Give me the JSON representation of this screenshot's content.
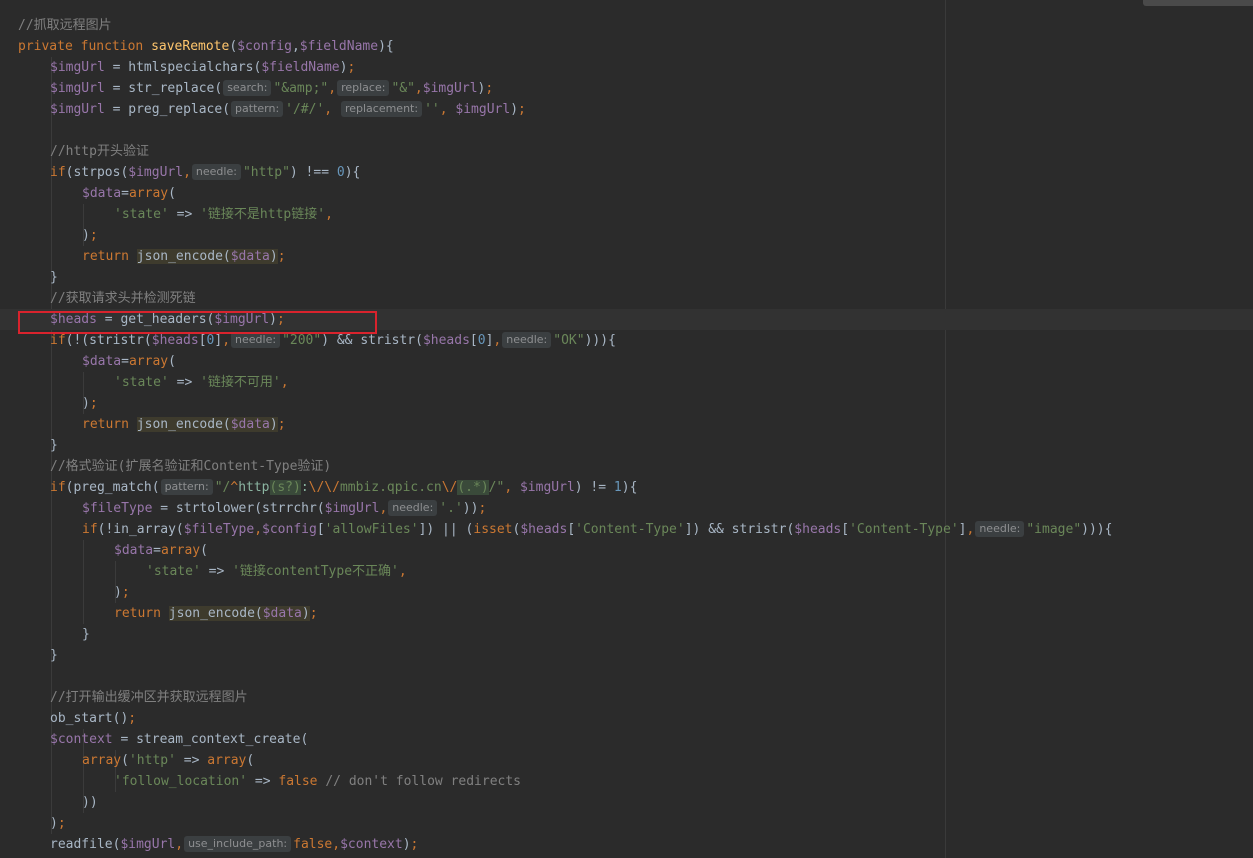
{
  "editor": {
    "theme": "darcula",
    "lines": [
      [
        [
          "com",
          "//抓取远程图片"
        ]
      ],
      [
        [
          "kw",
          "private function "
        ],
        [
          "fn",
          "saveRemote"
        ],
        [
          "def",
          "("
        ],
        [
          "var",
          "$config"
        ],
        [
          "def",
          ","
        ],
        [
          "var",
          "$fieldName"
        ],
        [
          "def",
          "){"
        ]
      ],
      [
        [
          "var",
          "$imgUrl"
        ],
        [
          "def",
          " = htmlspecialchars("
        ],
        [
          "var",
          "$fieldName"
        ],
        [
          "def",
          ")"
        ],
        [
          "kw",
          ";"
        ]
      ],
      [
        [
          "var",
          "$imgUrl"
        ],
        [
          "def",
          " = str_replace("
        ],
        [
          "hint",
          "search:"
        ],
        [
          "str",
          "\"&amp;\""
        ],
        [
          "kw",
          ","
        ],
        [
          "hint",
          "replace:"
        ],
        [
          "str",
          "\"&\""
        ],
        [
          "kw",
          ","
        ],
        [
          "var",
          "$imgUrl"
        ],
        [
          "def",
          ")"
        ],
        [
          "kw",
          ";"
        ]
      ],
      [
        [
          "var",
          "$imgUrl"
        ],
        [
          "def",
          " = preg_replace("
        ],
        [
          "hint",
          "pattern:"
        ],
        [
          "str",
          "'/#/'"
        ],
        [
          "kw",
          ", "
        ],
        [
          "hint",
          "replacement:"
        ],
        [
          "str",
          "''"
        ],
        [
          "kw",
          ", "
        ],
        [
          "var",
          "$imgUrl"
        ],
        [
          "def",
          ")"
        ],
        [
          "kw",
          ";"
        ]
      ],
      [],
      [
        [
          "com",
          "//http开头验证"
        ]
      ],
      [
        [
          "kw",
          "if"
        ],
        [
          "def",
          "(strpos("
        ],
        [
          "var",
          "$imgUrl"
        ],
        [
          "kw",
          ","
        ],
        [
          "hint",
          "needle:"
        ],
        [
          "str",
          "\"http\""
        ],
        [
          "def",
          ") !== "
        ],
        [
          "num",
          "0"
        ],
        [
          "def",
          "){"
        ]
      ],
      [
        [
          "var",
          "$data"
        ],
        [
          "def",
          "="
        ],
        [
          "kw",
          "array"
        ],
        [
          "def",
          "("
        ]
      ],
      [
        [
          "str",
          "'state'"
        ],
        [
          "def",
          " => "
        ],
        [
          "str",
          "'链接不是http链接'"
        ],
        [
          "kw",
          ","
        ]
      ],
      [
        [
          "def",
          ")"
        ],
        [
          "kw",
          ";"
        ]
      ],
      [
        [
          "kw",
          "return "
        ],
        [
          "call",
          "json_encode("
        ],
        [
          "callv",
          "$data"
        ],
        [
          "call",
          ")"
        ],
        [
          "kw",
          ";"
        ]
      ],
      [
        [
          "def",
          "}"
        ]
      ],
      [
        [
          "com",
          "//获取请求头并检测死链"
        ]
      ],
      [
        [
          "var",
          "$heads"
        ],
        [
          "def",
          " = get_headers("
        ],
        [
          "var",
          "$imgUrl"
        ],
        [
          "def",
          ")"
        ],
        [
          "kw",
          ";"
        ]
      ],
      [
        [
          "kw",
          "if"
        ],
        [
          "def",
          "(!(stristr("
        ],
        [
          "var",
          "$heads"
        ],
        [
          "def",
          "["
        ],
        [
          "num",
          "0"
        ],
        [
          "def",
          "]"
        ],
        [
          "kw",
          ","
        ],
        [
          "hint",
          "needle:"
        ],
        [
          "str",
          "\"200\""
        ],
        [
          "def",
          ") && stristr("
        ],
        [
          "var",
          "$heads"
        ],
        [
          "def",
          "["
        ],
        [
          "num",
          "0"
        ],
        [
          "def",
          "]"
        ],
        [
          "kw",
          ","
        ],
        [
          "hint",
          "needle:"
        ],
        [
          "str",
          "\"OK\""
        ],
        [
          "def",
          ")))"
        ],
        [
          "def",
          "{"
        ]
      ],
      [
        [
          "var",
          "$data"
        ],
        [
          "def",
          "="
        ],
        [
          "kw",
          "array"
        ],
        [
          "def",
          "("
        ]
      ],
      [
        [
          "str",
          "'state'"
        ],
        [
          "def",
          " => "
        ],
        [
          "str",
          "'链接不可用'"
        ],
        [
          "kw",
          ","
        ]
      ],
      [
        [
          "def",
          ")"
        ],
        [
          "kw",
          ";"
        ]
      ],
      [
        [
          "kw",
          "return "
        ],
        [
          "call",
          "json_encode("
        ],
        [
          "callv",
          "$data"
        ],
        [
          "call",
          ")"
        ],
        [
          "kw",
          ";"
        ]
      ],
      [
        [
          "def",
          "}"
        ]
      ],
      [
        [
          "com",
          "//格式验证(扩展名验证和Content-Type验证)"
        ]
      ],
      [
        [
          "kw",
          "if"
        ],
        [
          "def",
          "(preg_match("
        ],
        [
          "hint",
          "pattern:"
        ],
        [
          "str",
          "\"/"
        ],
        [
          "esc",
          "^"
        ],
        [
          "rx",
          "http"
        ],
        [
          "rxb",
          "(s?)"
        ],
        [
          "rx",
          ":"
        ],
        [
          "esc",
          "\\/\\/"
        ],
        [
          "str",
          "mmbiz.qpic.cn"
        ],
        [
          "esc",
          "\\/"
        ],
        [
          "rxb",
          "(.*)"
        ],
        [
          "str",
          "/\""
        ],
        [
          "kw",
          ", "
        ],
        [
          "var",
          "$imgUrl"
        ],
        [
          "def",
          ") != "
        ],
        [
          "num",
          "1"
        ],
        [
          "def",
          "){"
        ]
      ],
      [
        [
          "var",
          "$fileType"
        ],
        [
          "def",
          " = strtolower(strrchr("
        ],
        [
          "var",
          "$imgUrl"
        ],
        [
          "kw",
          ","
        ],
        [
          "hint",
          "needle:"
        ],
        [
          "str",
          "'.'"
        ],
        [
          "def",
          "))"
        ],
        [
          "kw",
          ";"
        ]
      ],
      [
        [
          "kw",
          "if"
        ],
        [
          "def",
          "(!in_array("
        ],
        [
          "var",
          "$fileType"
        ],
        [
          "kw",
          ","
        ],
        [
          "var",
          "$config"
        ],
        [
          "def",
          "["
        ],
        [
          "str",
          "'allowFiles'"
        ],
        [
          "def",
          "]) || ("
        ],
        [
          "kw",
          "isset"
        ],
        [
          "def",
          "("
        ],
        [
          "var",
          "$heads"
        ],
        [
          "def",
          "["
        ],
        [
          "str",
          "'Content-Type'"
        ],
        [
          "def",
          "]) && stristr("
        ],
        [
          "var",
          "$heads"
        ],
        [
          "def",
          "["
        ],
        [
          "str",
          "'Content-Type'"
        ],
        [
          "def",
          "]"
        ],
        [
          "kw",
          ","
        ],
        [
          "hint",
          "needle:"
        ],
        [
          "str",
          "\"image\""
        ],
        [
          "def",
          ")))"
        ],
        [
          "def",
          "{"
        ]
      ],
      [
        [
          "var",
          "$data"
        ],
        [
          "def",
          "="
        ],
        [
          "kw",
          "array"
        ],
        [
          "def",
          "("
        ]
      ],
      [
        [
          "str",
          "'state'"
        ],
        [
          "def",
          " => "
        ],
        [
          "str",
          "'链接contentType不正确'"
        ],
        [
          "kw",
          ","
        ]
      ],
      [
        [
          "def",
          ")"
        ],
        [
          "kw",
          ";"
        ]
      ],
      [
        [
          "kw",
          "return "
        ],
        [
          "call",
          "json_encode("
        ],
        [
          "callv",
          "$data"
        ],
        [
          "call",
          ")"
        ],
        [
          "kw",
          ";"
        ]
      ],
      [
        [
          "def",
          "}"
        ]
      ],
      [
        [
          "def",
          "}"
        ]
      ],
      [],
      [
        [
          "com",
          "//打开输出缓冲区并获取远程图片"
        ]
      ],
      [
        [
          "def",
          "ob_start()"
        ],
        [
          "kw",
          ";"
        ]
      ],
      [
        [
          "var",
          "$context"
        ],
        [
          "def",
          " = stream_context_create("
        ]
      ],
      [
        [
          "kw",
          "array"
        ],
        [
          "def",
          "("
        ],
        [
          "str",
          "'http'"
        ],
        [
          "def",
          " => "
        ],
        [
          "kw",
          "array"
        ],
        [
          "def",
          "("
        ]
      ],
      [
        [
          "str",
          "'follow_location'"
        ],
        [
          "def",
          " => "
        ],
        [
          "kw",
          "false"
        ],
        [
          "com",
          " // don't follow redirects"
        ]
      ],
      [
        [
          "def",
          "))"
        ]
      ],
      [
        [
          "def",
          ")"
        ],
        [
          "kw",
          ";"
        ]
      ],
      [
        [
          "def",
          "readfile("
        ],
        [
          "var",
          "$imgUrl"
        ],
        [
          "kw",
          ","
        ],
        [
          "hint",
          "use_include_path:"
        ],
        [
          "kw",
          "false"
        ],
        [
          "kw",
          ","
        ],
        [
          "var",
          "$context"
        ],
        [
          "def",
          ")"
        ],
        [
          "kw",
          ";"
        ]
      ]
    ]
  }
}
